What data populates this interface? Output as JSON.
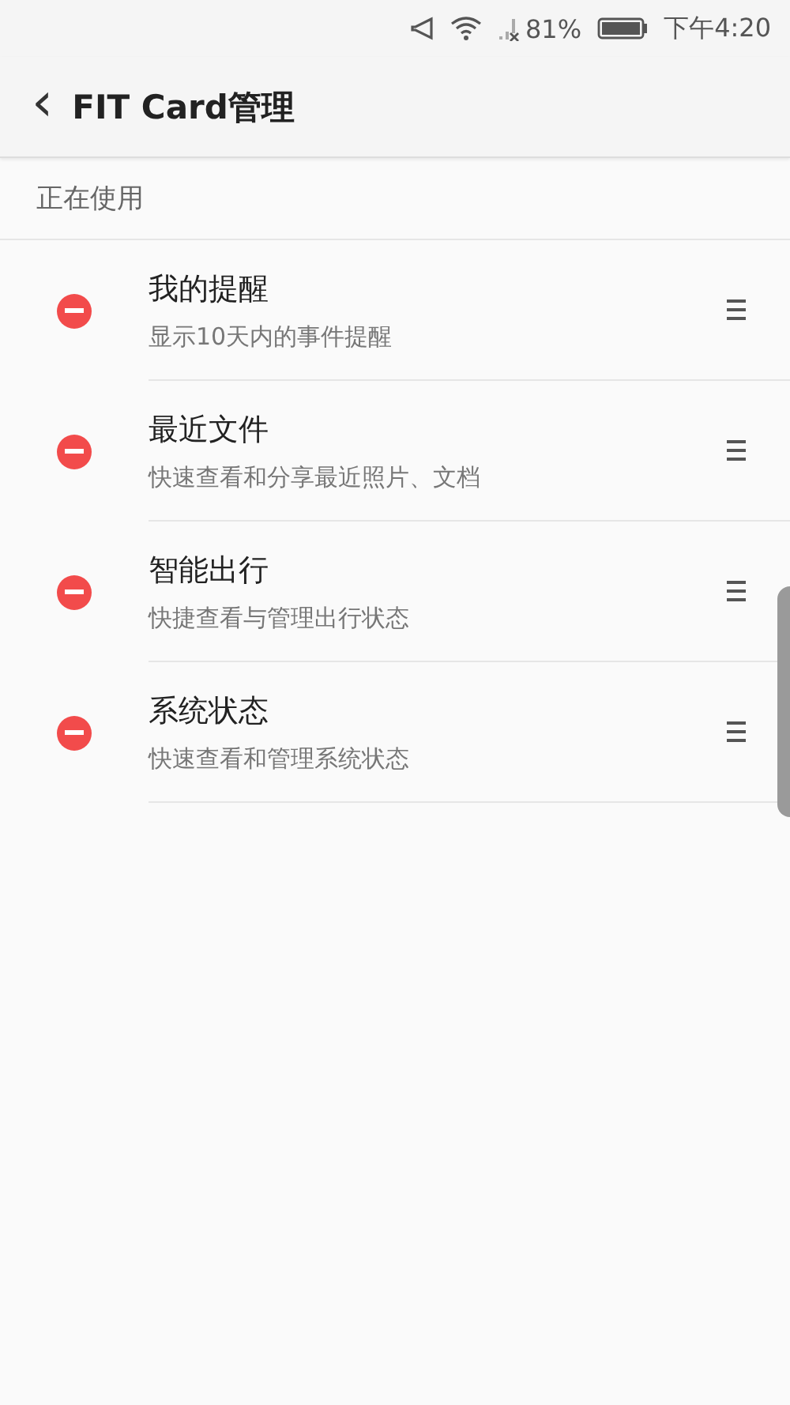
{
  "status_bar": {
    "battery": "81%",
    "time": "下午4:20"
  },
  "header": {
    "back": "‹",
    "title": "FIT Card管理"
  },
  "section": {
    "title": "正在使用"
  },
  "cards": [
    {
      "title": "我的提醒",
      "subtitle": "显示10天内的事件提醒"
    },
    {
      "title": "最近文件",
      "subtitle": "快速查看和分享最近照片、文档"
    },
    {
      "title": "智能出行",
      "subtitle": "快捷查看与管理出行状态"
    },
    {
      "title": "系统状态",
      "subtitle": "快速查看和管理系统状态"
    }
  ]
}
